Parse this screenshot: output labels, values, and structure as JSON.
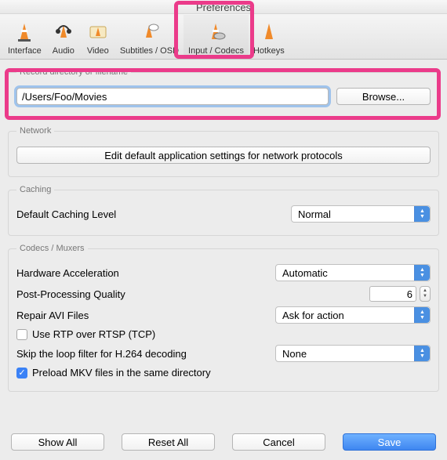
{
  "window": {
    "title": "Preferences"
  },
  "tabs": [
    {
      "label": "Interface"
    },
    {
      "label": "Audio"
    },
    {
      "label": "Video"
    },
    {
      "label": "Subtitles / OSD"
    },
    {
      "label": "Input / Codecs"
    },
    {
      "label": "Hotkeys"
    }
  ],
  "record": {
    "legend": "Record directory or filename",
    "path": "/Users/Foo/Movies",
    "browse": "Browse..."
  },
  "network": {
    "legend": "Network",
    "button": "Edit default application settings for network protocols"
  },
  "caching": {
    "legend": "Caching",
    "label": "Default Caching Level",
    "value": "Normal"
  },
  "codecs": {
    "legend": "Codecs / Muxers",
    "hw_label": "Hardware Acceleration",
    "hw_value": "Automatic",
    "pp_label": "Post-Processing Quality",
    "pp_value": "6",
    "repair_label": "Repair AVI Files",
    "repair_value": "Ask for action",
    "rtp_label": "Use RTP over RTSP (TCP)",
    "rtp_checked": false,
    "loop_label": "Skip the loop filter for H.264 decoding",
    "loop_value": "None",
    "mkv_label": "Preload MKV files in the same directory",
    "mkv_checked": true
  },
  "footer": {
    "show_all": "Show All",
    "reset_all": "Reset All",
    "cancel": "Cancel",
    "save": "Save"
  }
}
